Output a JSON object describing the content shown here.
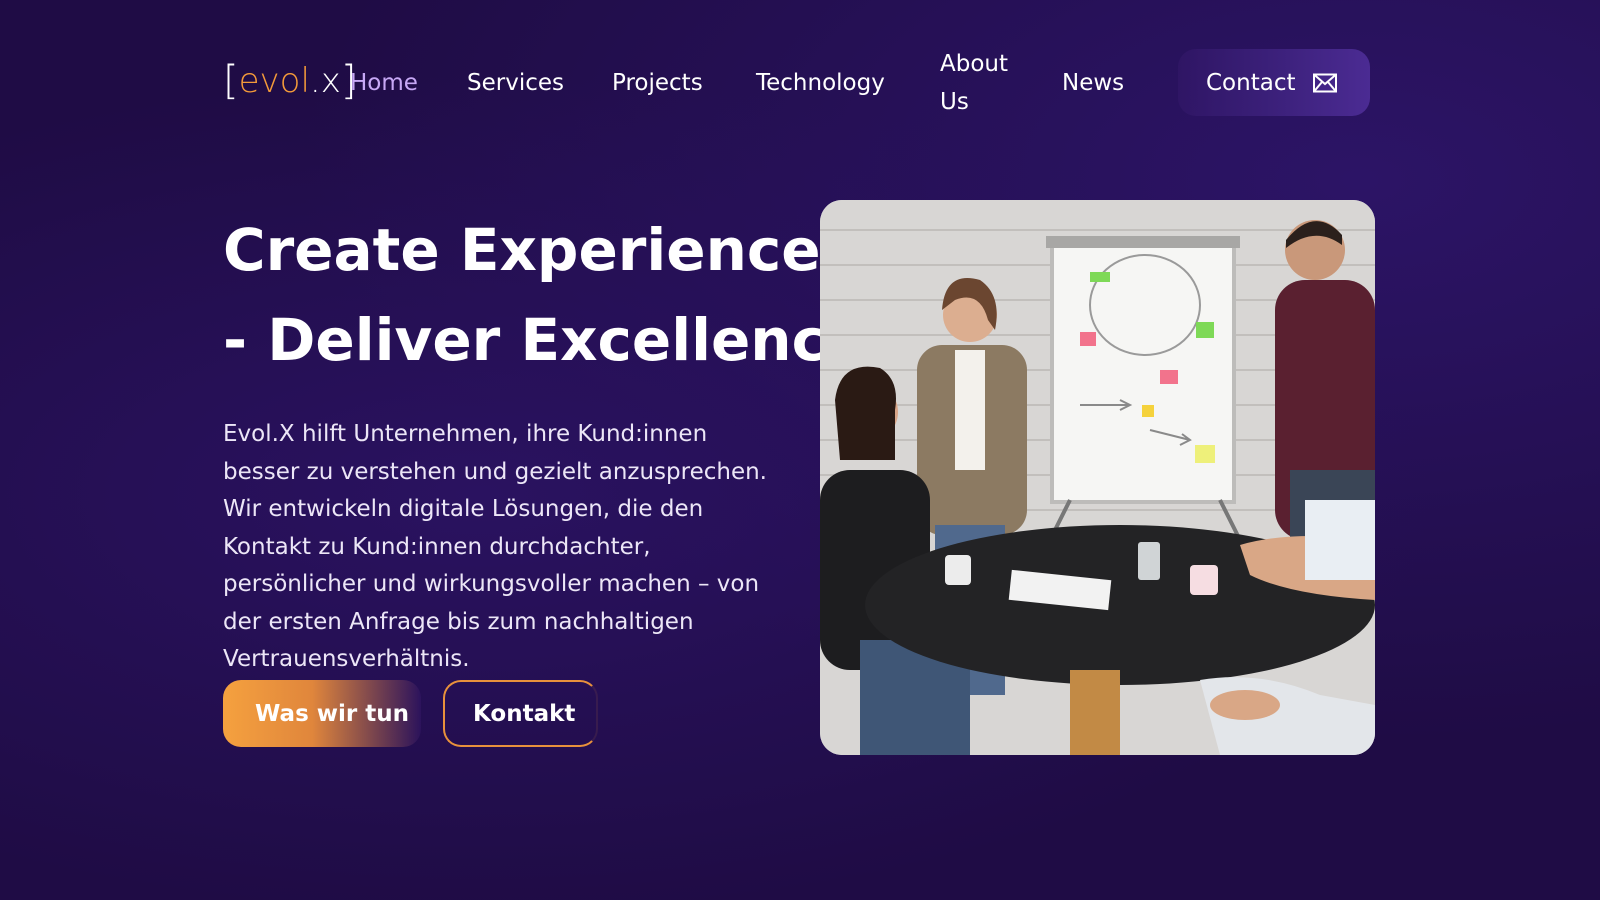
{
  "logo": {
    "bracket_open": "[",
    "evol": "evol",
    "dot": ".",
    "x": "x",
    "bracket_close": "]"
  },
  "nav": {
    "home": "Home",
    "services": "Services",
    "projects": "Projects",
    "technology": "Technology",
    "about": "About Us",
    "news": "News",
    "contact": "Contact"
  },
  "hero": {
    "title_line1": "Create Experience",
    "title_line2": "- Deliver Excellence",
    "text": "Evol.X hilft Unternehmen, ihre Kund:innen besser zu verstehen und gezielt anzusprechen. Wir entwickeln digitale Lösungen, die den Kontakt zu Kund:innen durchdachter, persönlicher und wirkungsvoller machen – von der ersten Anfrage bis zum nachhaltigen Vertrauensverhältnis.",
    "primary_button": "Was wir tun",
    "secondary_button": "Kontakt"
  },
  "colors": {
    "background": "#1f0c45",
    "accent_orange": "#f39a3a",
    "active_nav": "#c7a8f5",
    "contact_button": "#3a1f78"
  },
  "icons": {
    "contact": "mail-icon"
  }
}
